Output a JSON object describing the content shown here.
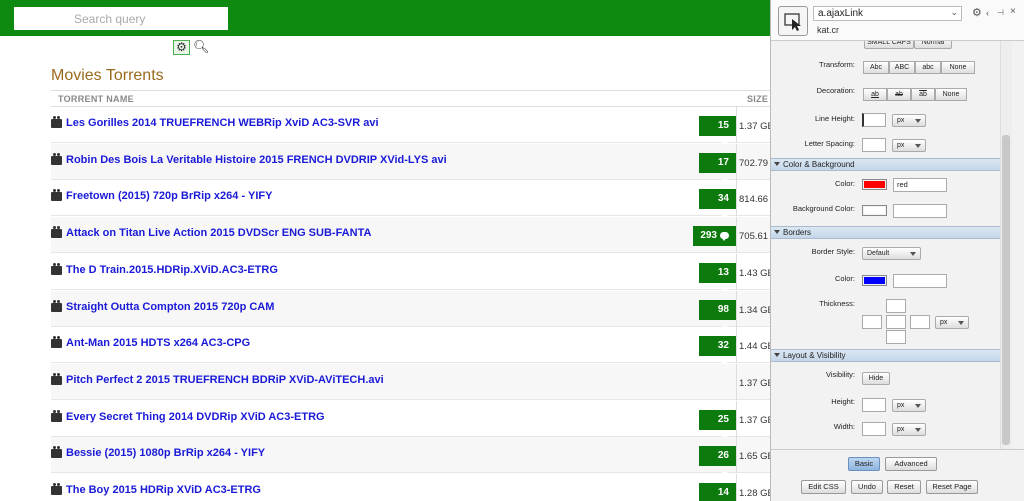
{
  "search": {
    "placeholder": "Search query"
  },
  "title": "Movies Torrents",
  "columns": {
    "name": "TORRENT NAME",
    "size": "SIZE"
  },
  "rows": [
    {
      "name": "Les Gorilles 2014 TRUEFRENCH WEBRip XviD AC3-SVR avi",
      "comments": "15",
      "size": "1.37 GB"
    },
    {
      "name": "Robin Des Bois La Veritable Histoire 2015 FRENCH DVDRIP XVid-LYS avi",
      "comments": "17",
      "size": "702.79 MB"
    },
    {
      "name": "Freetown (2015) 720p BrRip x264 - YIFY",
      "comments": "34",
      "size": "814.66 MB"
    },
    {
      "name": "Attack on Titan Live Action 2015 DVDScr ENG SUB-FANTA",
      "comments": "293",
      "size": "705.61 MB"
    },
    {
      "name": "The D Train.2015.HDRip.XViD.AC3-ETRG",
      "comments": "13",
      "size": "1.43 GB"
    },
    {
      "name": "Straight Outta Compton 2015 720p CAM",
      "comments": "98",
      "size": "1.34 GB"
    },
    {
      "name": "Ant-Man 2015 HDTS x264 AC3-CPG",
      "comments": "32",
      "size": "1.44 GB"
    },
    {
      "name": "Pitch Perfect 2 2015 TRUEFRENCH BDRiP XViD-AViTECH.avi",
      "comments": "",
      "size": "1.37 GB"
    },
    {
      "name": "Every Secret Thing 2014 DVDRip XViD AC3-ETRG",
      "comments": "25",
      "size": "1.37 GB"
    },
    {
      "name": "Bessie (2015) 1080p BrRip x264 - YIFY",
      "comments": "26",
      "size": "1.65 GB"
    },
    {
      "name": "The Boy 2015 HDRip XViD AC3-ETRG",
      "comments": "14",
      "size": "1.28 GB"
    }
  ],
  "panel": {
    "selector": "a.ajaxLink",
    "domain": "kat.cr",
    "top_cut_buttons": [
      "SMALL CAPS",
      "Normal"
    ],
    "transform_label": "Transform:",
    "transform_buttons": [
      "Abc",
      "ABC",
      "abc",
      "None"
    ],
    "decoration_label": "Decoration:",
    "decoration_buttons": [
      "ab",
      "ab",
      "ab",
      "None"
    ],
    "line_height_label": "Line Height:",
    "letter_spacing_label": "Letter Spacing:",
    "unit": "px",
    "color_bg_section": "Color & Background",
    "color_label": "Color:",
    "color_value": "red",
    "color_hex": "#ff0000",
    "background_color_label": "Background Color:",
    "borders_section": "Borders",
    "border_style_label": "Border Style:",
    "border_style_value": "Default",
    "border_color_label": "Color:",
    "border_color_hex": "#0000ff",
    "thickness_label": "Thickness:",
    "layout_section": "Layout & Visibility",
    "visibility_label": "Visibility:",
    "hide_button": "Hide",
    "height_label": "Height:",
    "width_label": "Width:",
    "mode_buttons": [
      "Basic",
      "Advanced"
    ],
    "footer_buttons": [
      "Edit CSS",
      "Undo",
      "Reset",
      "Reset Page"
    ]
  },
  "colors": {
    "brand_green": "#0e8a10",
    "link_blue": "#1a1ad8",
    "title_brown": "#9a6a1e"
  }
}
